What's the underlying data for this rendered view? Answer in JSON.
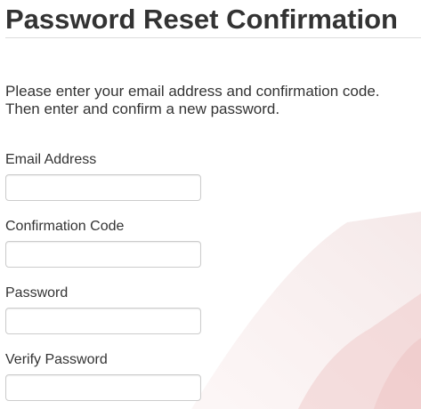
{
  "page": {
    "title": "Password Reset Confirmation",
    "instructions_line1": "Please enter your email address and confirmation code.",
    "instructions_line2": "Then enter and confirm a new password."
  },
  "form": {
    "fields": [
      {
        "label": "Email Address",
        "value": "",
        "placeholder": ""
      },
      {
        "label": "Confirmation Code",
        "value": "",
        "placeholder": ""
      },
      {
        "label": "Password",
        "value": "",
        "placeholder": ""
      },
      {
        "label": "Verify Password",
        "value": "",
        "placeholder": ""
      }
    ]
  },
  "theme": {
    "text_color": "#333333",
    "input_border": "#cccccc",
    "divider": "#dddddd",
    "decor_red": "#e8a0a0"
  }
}
